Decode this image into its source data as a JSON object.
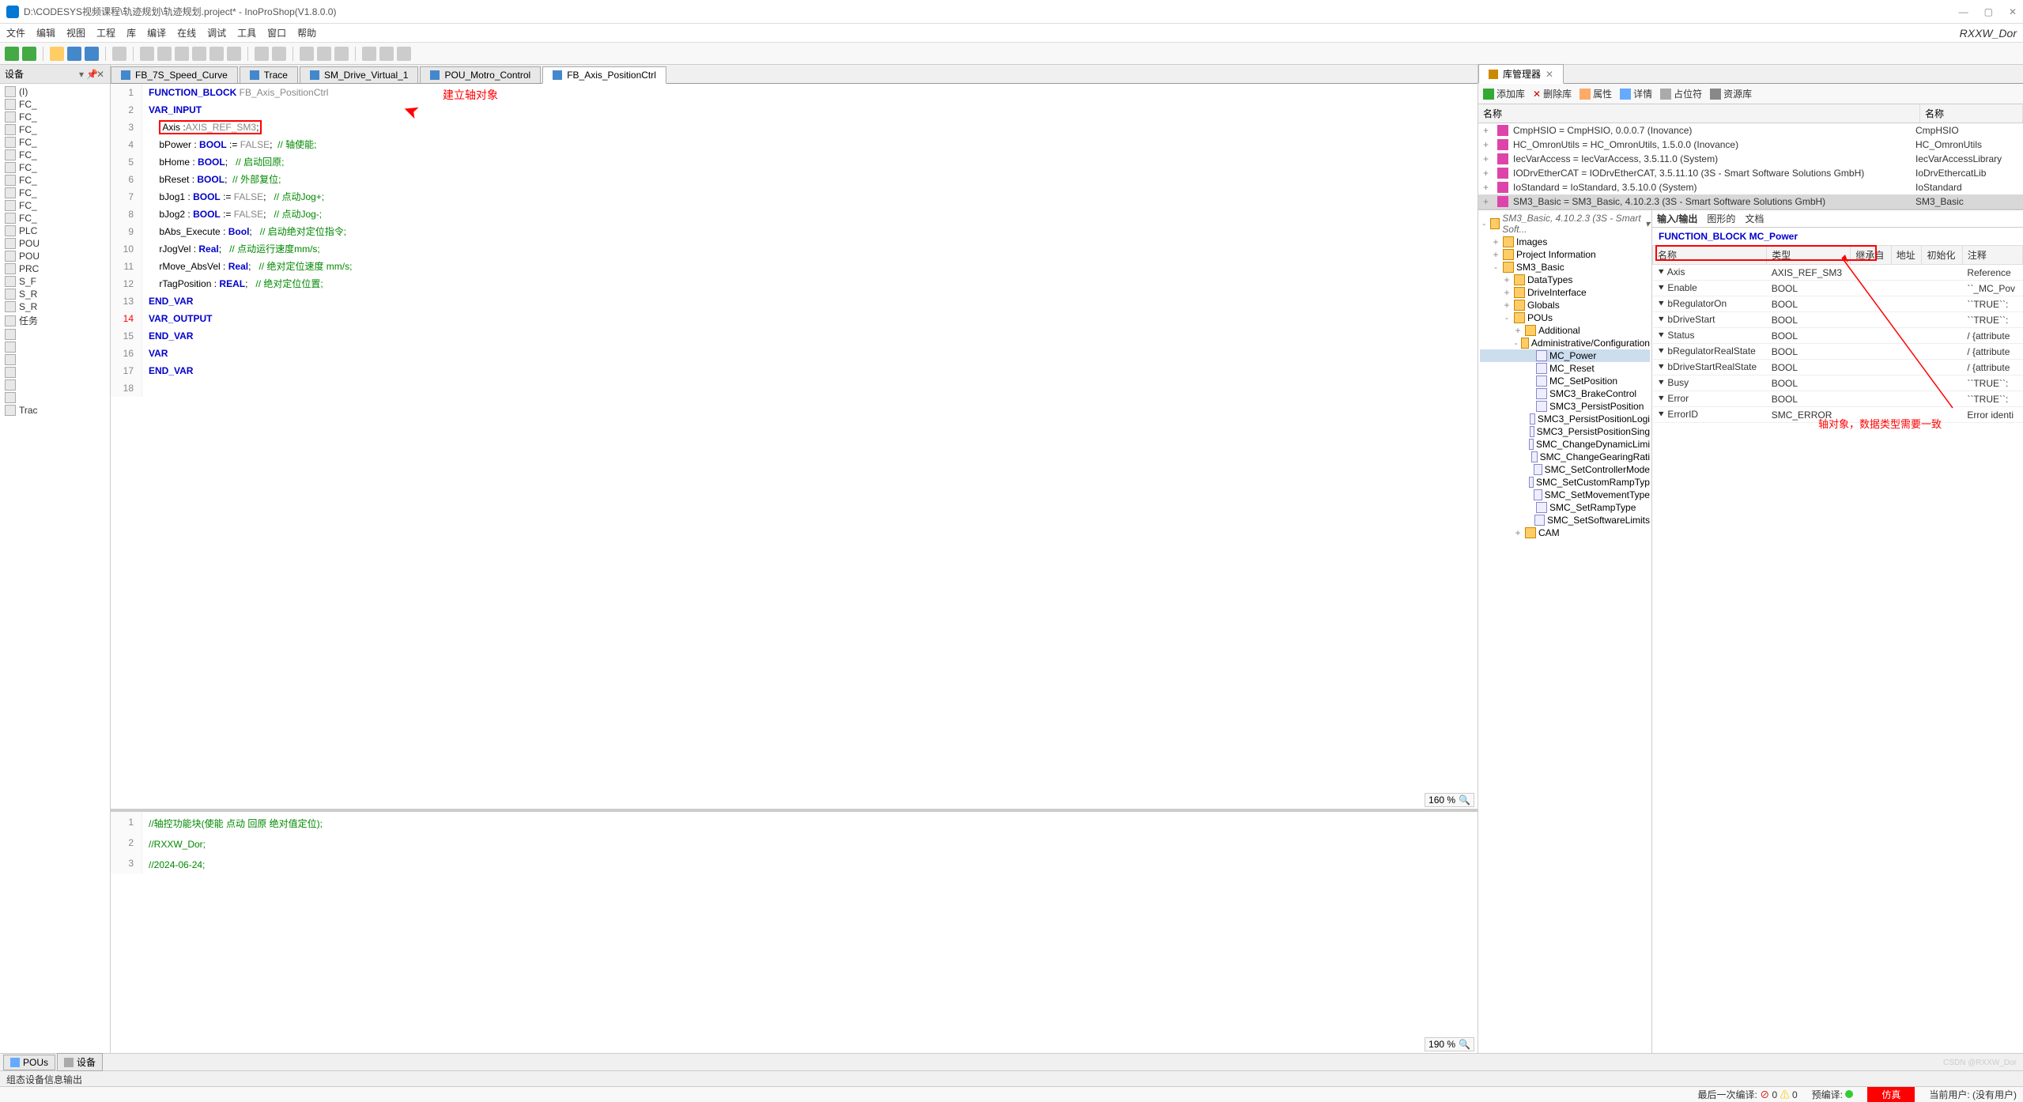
{
  "window": {
    "title": "D:\\CODESYS视频课程\\轨迹规划\\轨迹规划.project* - InoProShop(V1.8.0.0)",
    "rlabel": "RXXW_Dor"
  },
  "menu": [
    "文件",
    "编辑",
    "视图",
    "工程",
    "库",
    "编译",
    "在线",
    "调试",
    "工具",
    "窗口",
    "帮助"
  ],
  "leftpanel": {
    "title": "设备",
    "items": [
      "(I)",
      "FC_",
      "FC_",
      "FC_",
      "FC_",
      "FC_",
      "FC_",
      "FC_",
      "FC_",
      "FC_",
      "FC_",
      "PLC",
      "POU",
      "POU",
      "PRC",
      "S_F",
      "S_R",
      "S_R",
      "任务",
      "",
      "",
      "",
      "",
      "",
      "",
      "Trac"
    ]
  },
  "tabs": [
    {
      "label": "FB_7S_Speed_Curve"
    },
    {
      "label": "Trace"
    },
    {
      "label": "SM_Drive_Virtual_1"
    },
    {
      "label": "POU_Motro_Control"
    },
    {
      "label": "FB_Axis_PositionCtrl",
      "active": true
    }
  ],
  "code_top": {
    "lines": [
      {
        "n": 1,
        "html": "<span class='kw'>FUNCTION_BLOCK</span> <span class='tyref'>FB_Axis_PositionCtrl</span>"
      },
      {
        "n": 2,
        "html": "<span class='kw'>VAR_INPUT</span>"
      },
      {
        "n": 3,
        "html": "    <span class='redbox'><span class='nm'>Axis :</span><span class='tyref'>AXIS_REF_SM3</span>;</span>"
      },
      {
        "n": 4,
        "html": "    <span class='nm'>bPower</span> : <span class='ty'>BOOL</span> := <span class='bl'>FALSE</span>;  <span class='cm'>// 轴使能;</span>"
      },
      {
        "n": 5,
        "html": "    <span class='nm'>bHome</span> : <span class='ty'>BOOL</span>;   <span class='cm'>// 启动回原;</span>"
      },
      {
        "n": 6,
        "html": "    <span class='nm'>bReset</span> : <span class='ty'>BOOL</span>;  <span class='cm'>// 外部复位;</span>"
      },
      {
        "n": 7,
        "html": "    <span class='nm'>bJog1</span> : <span class='ty'>BOOL</span> := <span class='bl'>FALSE</span>;   <span class='cm'>// 点动Jog+;</span>"
      },
      {
        "n": 8,
        "html": "    <span class='nm'>bJog2</span> : <span class='ty'>BOOL</span> := <span class='bl'>FALSE</span>;   <span class='cm'>// 点动Jog-;</span>"
      },
      {
        "n": 9,
        "html": "    <span class='nm'>bAbs_Execute</span> : <span class='ty'>Bool</span>;   <span class='cm'>// 启动绝对定位指令;</span>"
      },
      {
        "n": 10,
        "html": "    <span class='nm'>rJogVel</span> : <span class='ty'>Real</span>;   <span class='cm'>// 点动运行速度mm/s;</span>"
      },
      {
        "n": 11,
        "html": "    <span class='nm'>rMove_AbsVel</span> : <span class='ty'>Real</span>;   <span class='cm'>// 绝对定位速度 mm/s;</span>"
      },
      {
        "n": 12,
        "html": "    <span class='nm'>rTagPosition</span> : <span class='ty'>REAL</span>;   <span class='cm'>// 绝对定位位置;</span>"
      },
      {
        "n": 13,
        "html": "<span class='kw'>END_VAR</span>"
      },
      {
        "n": 14,
        "html": "<span class='kw'>VAR_OUTPUT</span>",
        "red": true
      },
      {
        "n": 15,
        "html": "<span class='kw'>END_VAR</span>"
      },
      {
        "n": 16,
        "html": "<span class='kw'>VAR</span>"
      },
      {
        "n": 17,
        "html": "<span class='kw'>END_VAR</span>"
      },
      {
        "n": 18,
        "html": ""
      }
    ],
    "annotation": "建立轴对象",
    "zoom": "160 %"
  },
  "code_bot": {
    "lines": [
      {
        "n": 1,
        "html": "<span class='cm'>//轴控功能块(使能 点动 回原 绝对值定位);</span>"
      },
      {
        "n": 2,
        "html": "<span class='cm'>//RXXW_Dor;</span>"
      },
      {
        "n": 3,
        "html": "<span class='cm'>//2024-06-24;</span>"
      }
    ],
    "zoom": "190 %"
  },
  "rightpanel": {
    "tab": "库管理器",
    "toolbar": [
      "添加库",
      "删除库",
      "属性",
      "详情",
      "占位符",
      "资源库"
    ],
    "libhdr_name": "名称",
    "libhdr_ns": "名称",
    "libs": [
      {
        "name": "CmpHSIO = CmpHSIO, 0.0.0.7 (Inovance)",
        "ns": "CmpHSIO"
      },
      {
        "name": "HC_OmronUtils = HC_OmronUtils, 1.5.0.0 (Inovance)",
        "ns": "HC_OmronUtils"
      },
      {
        "name": "IecVarAccess = IecVarAccess, 3.5.11.0 (System)",
        "ns": "IecVarAccessLibrary"
      },
      {
        "name": "IODrvEtherCAT = IODrvEtherCAT, 3.5.11.10 (3S - Smart Software Solutions GmbH)",
        "ns": "IoDrvEthercatLib"
      },
      {
        "name": "IoStandard = IoStandard, 3.5.10.0 (System)",
        "ns": "IoStandard"
      },
      {
        "name": "SM3_Basic = SM3_Basic, 4.10.2.3 (3S - Smart Software Solutions GmbH)",
        "ns": "SM3_Basic",
        "sel": true
      }
    ],
    "tree_title": "SM3_Basic, 4.10.2.3 (3S - Smart Soft...",
    "tree": [
      {
        "label": "Images",
        "t": "folder",
        "ind": 1,
        "exp": "+"
      },
      {
        "label": "Project Information",
        "t": "folder",
        "ind": 1,
        "exp": "+"
      },
      {
        "label": "SM3_Basic",
        "t": "folder",
        "ind": 1,
        "exp": "-"
      },
      {
        "label": "DataTypes",
        "t": "folder",
        "ind": 2,
        "exp": "+"
      },
      {
        "label": "DriveInterface",
        "t": "folder",
        "ind": 2,
        "exp": "+"
      },
      {
        "label": "Globals",
        "t": "folder",
        "ind": 2,
        "exp": "+"
      },
      {
        "label": "POUs",
        "t": "folder",
        "ind": 2,
        "exp": "-"
      },
      {
        "label": "Additional",
        "t": "folder",
        "ind": 3,
        "exp": "+"
      },
      {
        "label": "Administrative/Configuration",
        "t": "folder",
        "ind": 3,
        "exp": "-"
      },
      {
        "label": "MC_Power",
        "t": "file",
        "ind": 4,
        "sel": true
      },
      {
        "label": "MC_Reset",
        "t": "file",
        "ind": 4
      },
      {
        "label": "MC_SetPosition",
        "t": "file",
        "ind": 4
      },
      {
        "label": "SMC3_BrakeControl",
        "t": "file",
        "ind": 4
      },
      {
        "label": "SMC3_PersistPosition",
        "t": "file",
        "ind": 4
      },
      {
        "label": "SMC3_PersistPositionLogi",
        "t": "file",
        "ind": 4
      },
      {
        "label": "SMC3_PersistPositionSing",
        "t": "file",
        "ind": 4
      },
      {
        "label": "SMC_ChangeDynamicLimi",
        "t": "file",
        "ind": 4
      },
      {
        "label": "SMC_ChangeGearingRati",
        "t": "file",
        "ind": 4
      },
      {
        "label": "SMC_SetControllerMode",
        "t": "file",
        "ind": 4
      },
      {
        "label": "SMC_SetCustomRampTyp",
        "t": "file",
        "ind": 4
      },
      {
        "label": "SMC_SetMovementType",
        "t": "file",
        "ind": 4
      },
      {
        "label": "SMC_SetRampType",
        "t": "file",
        "ind": 4
      },
      {
        "label": "SMC_SetSoftwareLimits",
        "t": "file",
        "ind": 4
      },
      {
        "label": "CAM",
        "t": "folder",
        "ind": 3,
        "exp": "+"
      }
    ],
    "dtabs": [
      "输入/输出",
      "图形的",
      "文档"
    ],
    "fb_title": "FUNCTION_BLOCK MC_Power",
    "tbl_hdr": [
      "名称",
      "类型",
      "继承自",
      "地址",
      "初始化",
      "注释"
    ],
    "tbl_rows": [
      {
        "name": "Axis",
        "type": "AXIS_REF_SM3",
        "cmt": "Reference",
        "hl": true
      },
      {
        "name": "Enable",
        "type": "BOOL",
        "cmt": "``_MC_Pov"
      },
      {
        "name": "bRegulatorOn",
        "type": "BOOL",
        "cmt": "``TRUE``:"
      },
      {
        "name": "bDriveStart",
        "type": "BOOL",
        "cmt": "``TRUE``:"
      },
      {
        "name": "Status",
        "type": "BOOL",
        "cmt": "/ {attribute"
      },
      {
        "name": "bRegulatorRealState",
        "type": "BOOL",
        "cmt": "/ {attribute"
      },
      {
        "name": "bDriveStartRealState",
        "type": "BOOL",
        "cmt": "/ {attribute"
      },
      {
        "name": "Busy",
        "type": "BOOL",
        "cmt": "``TRUE``:"
      },
      {
        "name": "Error",
        "type": "BOOL",
        "cmt": "``TRUE``:"
      },
      {
        "name": "ErrorID",
        "type": "SMC_ERROR",
        "cmt": "Error identi"
      }
    ],
    "annotation2": "轴对象，数据类型需要一致"
  },
  "bottom_tabs": [
    "POUs",
    "设备"
  ],
  "msgbar": "组态设备信息输出",
  "status": {
    "lastcompile": "最后一次编译:",
    "lastcompile_val": "0",
    "lastcompile_val2": "0",
    "precompile": "预编译:",
    "sim": "仿真",
    "user": "当前用户: (没有用户)"
  },
  "watermark": "CSDN @RXXW_Dor"
}
